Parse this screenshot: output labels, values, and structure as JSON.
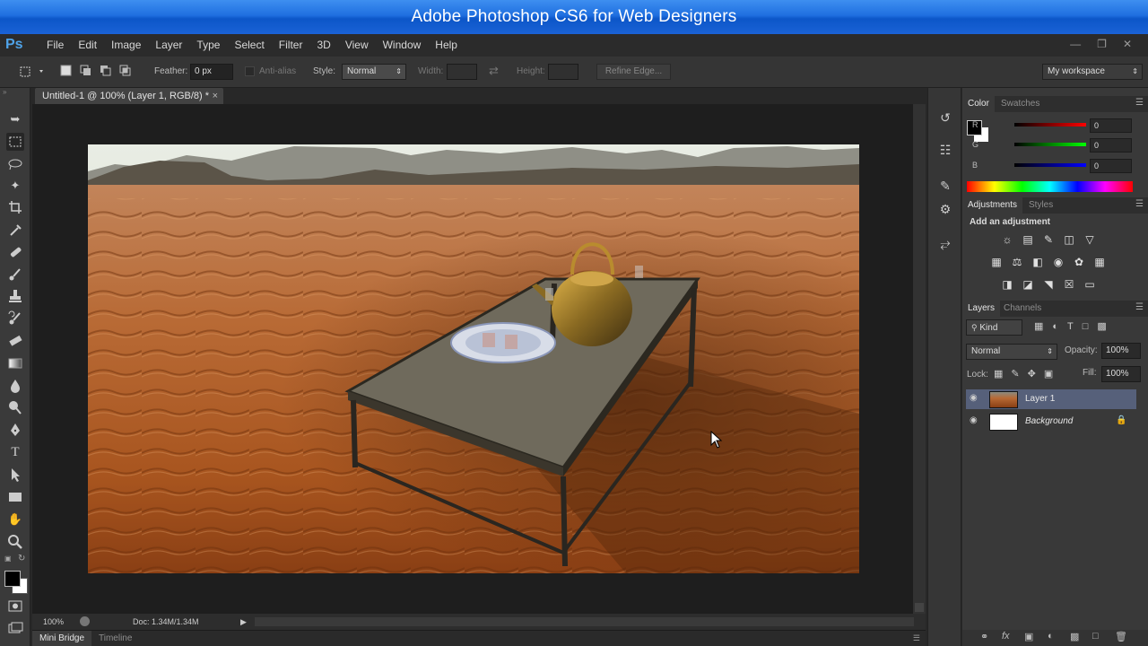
{
  "banner": {
    "title": "Adobe Photoshop CS6 for Web Designers"
  },
  "app": {
    "logo": "Ps",
    "menus": [
      "File",
      "Edit",
      "Image",
      "Layer",
      "Type",
      "Select",
      "Filter",
      "3D",
      "View",
      "Window",
      "Help"
    ]
  },
  "options": {
    "feather_label": "Feather:",
    "feather_value": "0 px",
    "antialias_label": "Anti-alias",
    "style_label": "Style:",
    "style_value": "Normal",
    "width_label": "Width:",
    "height_label": "Height:",
    "refine_edge": "Refine Edge...",
    "workspace": "My workspace"
  },
  "document": {
    "tab_title": "Untitled-1 @ 100% (Layer 1, RGB/8) *",
    "zoom": "100%",
    "doc_size": "Doc: 1.34M/1.34M"
  },
  "bottom_tabs": {
    "mini_bridge": "Mini Bridge",
    "timeline": "Timeline"
  },
  "color_panel": {
    "tab_color": "Color",
    "tab_swatches": "Swatches",
    "r_label": "R",
    "g_label": "G",
    "b_label": "B",
    "r_value": "0",
    "g_value": "0",
    "b_value": "0"
  },
  "adjustments_panel": {
    "tab_adjustments": "Adjustments",
    "tab_styles": "Styles",
    "heading": "Add an adjustment"
  },
  "layers_panel": {
    "tab_layers": "Layers",
    "tab_channels": "Channels",
    "kind": "Kind",
    "blend_mode": "Normal",
    "opacity_label": "Opacity:",
    "opacity_value": "100%",
    "lock_label": "Lock:",
    "fill_label": "Fill:",
    "fill_value": "100%",
    "layers": [
      {
        "name": "Layer 1",
        "selected": true
      },
      {
        "name": "Background",
        "locked": true
      }
    ]
  },
  "colors": {
    "accent": "#1f6fe0",
    "selected_layer": "#56607a"
  }
}
